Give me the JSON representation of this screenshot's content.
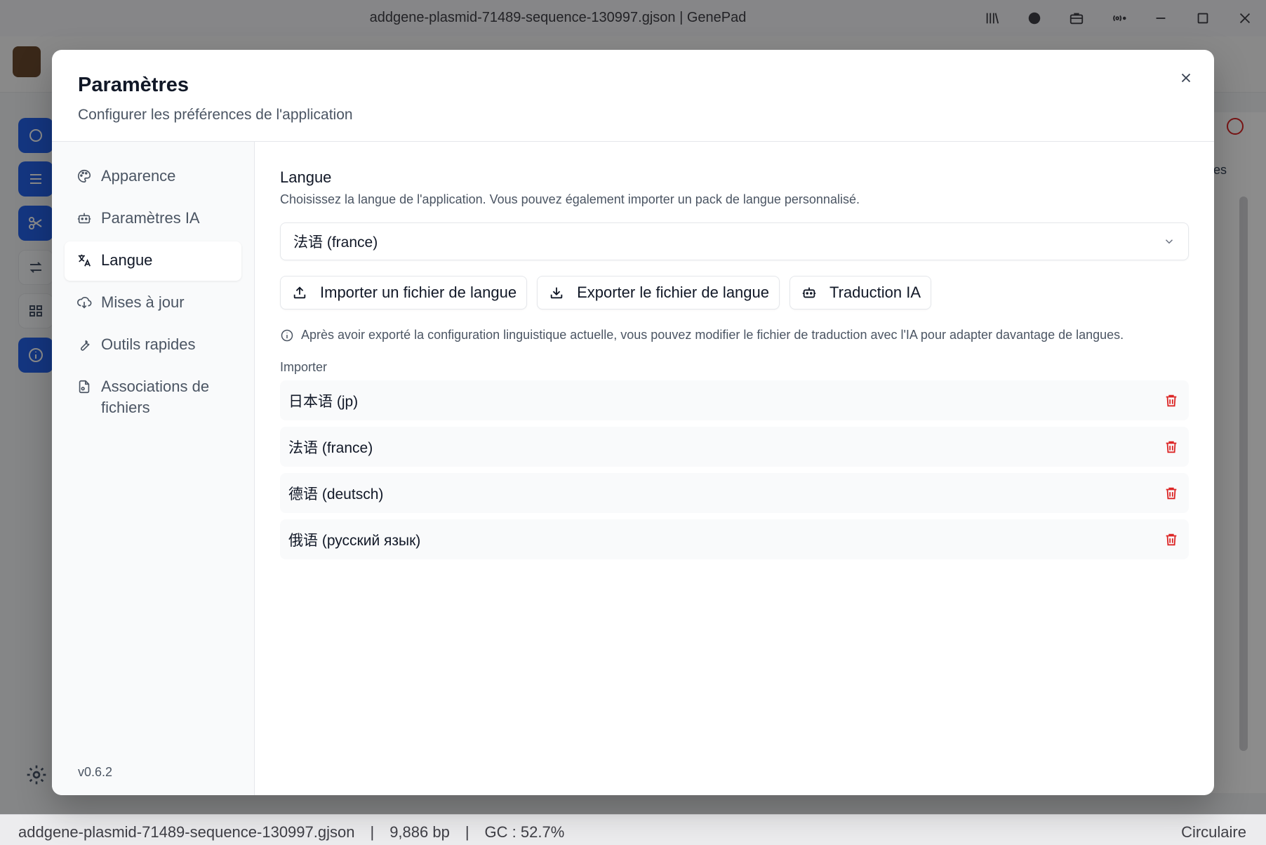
{
  "window": {
    "title": "addgene-plasmid-71489-sequence-130997.gjson | GenePad"
  },
  "titlebar_icons": [
    "library-icon",
    "ai-chat-icon",
    "briefcase-icon",
    "broadcast-icon",
    "minimize-icon",
    "maximize-icon",
    "close-icon"
  ],
  "background": {
    "right_panel_text": "ies"
  },
  "modal": {
    "title": "Paramètres",
    "subtitle": "Configurer les préférences de l'application",
    "nav": [
      {
        "label": "Apparence",
        "icon": "palette-icon",
        "active": false
      },
      {
        "label": "Paramètres IA",
        "icon": "bot-icon",
        "active": false
      },
      {
        "label": "Langue",
        "icon": "translate-icon",
        "active": true
      },
      {
        "label": "Mises à jour",
        "icon": "cloud-download-icon",
        "active": false
      },
      {
        "label": "Outils rapides",
        "icon": "wrench-icon",
        "active": false
      },
      {
        "label": "Associations de fichiers",
        "icon": "file-link-icon",
        "active": false
      }
    ],
    "version": "v0.6.2",
    "content": {
      "section_title": "Langue",
      "section_desc": "Choisissez la langue de l'application. Vous pouvez également importer un pack de langue personnalisé.",
      "selected_language": "法语 (france)",
      "buttons": {
        "import": "Importer un fichier de langue",
        "export": "Exporter le fichier de langue",
        "ai_translate": "Traduction IA"
      },
      "info": "Après avoir exporté la configuration linguistique actuelle, vous pouvez modifier le fichier de traduction avec l'IA pour adapter davantage de langues.",
      "import_label": "Importer",
      "languages": [
        "日本语 (jp)",
        "法语 (france)",
        "德语 (deutsch)",
        "俄语 (русский язык)"
      ]
    }
  },
  "statusbar": {
    "file": "addgene-plasmid-71489-sequence-130997.gjson",
    "sep": "|",
    "length": "9,886 bp",
    "gc": "GC : 52.7%",
    "topology": "Circulaire"
  }
}
